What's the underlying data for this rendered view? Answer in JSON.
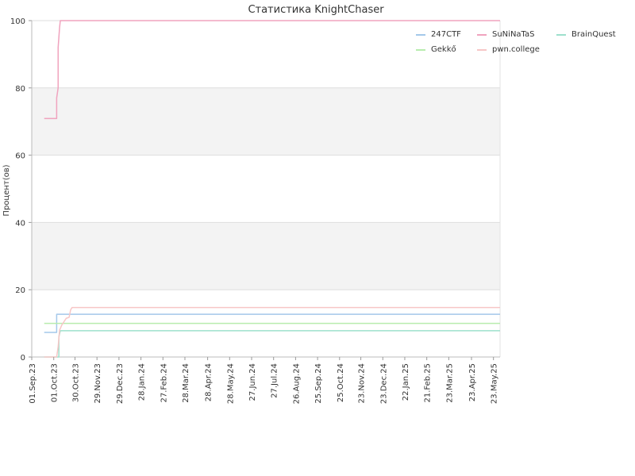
{
  "chart_data": {
    "type": "line",
    "title": "Статистика KnightChaser",
    "ylabel": "Процент(ов)",
    "xlabel": "",
    "ylim": [
      0,
      100
    ],
    "yticks": [
      0,
      20,
      40,
      60,
      80,
      100
    ],
    "xlim": [
      "2023-09-01",
      "2025-06-01"
    ],
    "xtick_dates": [
      "2023-09-01",
      "2023-10-01",
      "2023-10-30",
      "2023-11-29",
      "2023-12-29",
      "2024-01-28",
      "2024-02-27",
      "2024-03-28",
      "2024-04-28",
      "2024-05-28",
      "2024-06-27",
      "2024-07-27",
      "2024-08-26",
      "2024-09-25",
      "2024-10-25",
      "2024-11-23",
      "2024-12-23",
      "2025-01-22",
      "2025-02-21",
      "2025-03-23",
      "2025-04-23",
      "2025-05-23"
    ],
    "xtick_labels": [
      "01.Sep.23",
      "01.Oct.23",
      "30.Oct.23",
      "29.Nov.23",
      "29.Dec.23",
      "28.Jan.24",
      "27.Feb.24",
      "28.Mar.24",
      "28.Apr.24",
      "28.May.24",
      "27.Jun.24",
      "27.Jul.24",
      "26.Aug.24",
      "25.Sep.24",
      "25.Oct.24",
      "23.Nov.24",
      "23.Dec.24",
      "22.Jan.25",
      "21.Feb.25",
      "23.Mar.25",
      "23.Apr.25",
      "23.May.25"
    ],
    "grid": "horizontal, alternating bands",
    "legend": "top-right",
    "series": [
      {
        "name": "247CTF",
        "color": "#a4c8ea",
        "points": [
          [
            "2023-09-18",
            7.3
          ],
          [
            "2023-10-05",
            7.3
          ],
          [
            "2023-10-05",
            12.7
          ],
          [
            "2025-06-01",
            12.7
          ]
        ]
      },
      {
        "name": "SuNiNaTaS",
        "color": "#f0a3be",
        "points": [
          [
            "2023-09-18",
            70.9
          ],
          [
            "2023-10-05",
            70.9
          ],
          [
            "2023-10-05",
            77
          ],
          [
            "2023-10-07",
            80
          ],
          [
            "2023-10-07",
            92
          ],
          [
            "2023-10-08",
            95
          ],
          [
            "2023-10-09",
            98
          ],
          [
            "2023-10-10",
            100
          ],
          [
            "2025-06-01",
            100
          ]
        ]
      },
      {
        "name": "BrainQuest",
        "color": "#9de0cc",
        "points": [
          [
            "2023-09-18",
            0
          ],
          [
            "2023-10-08",
            0
          ],
          [
            "2023-10-08",
            6
          ],
          [
            "2023-10-10",
            7.8
          ],
          [
            "2025-06-01",
            7.8
          ]
        ]
      },
      {
        "name": "Gekkő",
        "color": "#b8ecae",
        "points": [
          [
            "2023-09-18",
            10
          ],
          [
            "2025-06-01",
            10
          ]
        ]
      },
      {
        "name": "pwn.college",
        "color": "#f7c6c6",
        "points": [
          [
            "2023-09-18",
            0
          ],
          [
            "2023-10-05",
            0
          ],
          [
            "2023-10-07",
            3
          ],
          [
            "2023-10-09",
            8
          ],
          [
            "2023-10-12",
            9.5
          ],
          [
            "2023-10-15",
            10.5
          ],
          [
            "2023-10-18",
            11.5
          ],
          [
            "2023-10-22",
            11.8
          ],
          [
            "2023-10-24",
            14
          ],
          [
            "2023-10-26",
            14.7
          ],
          [
            "2025-06-01",
            14.7
          ]
        ]
      }
    ]
  }
}
